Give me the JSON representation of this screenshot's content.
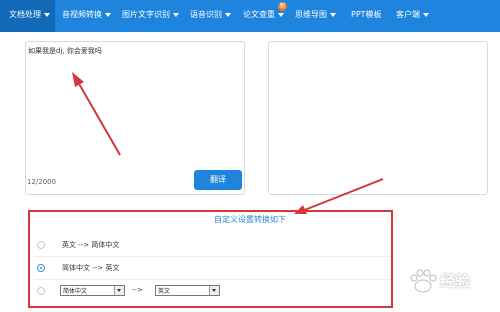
{
  "nav": {
    "items": [
      {
        "label": "文档处理",
        "active": true
      },
      {
        "label": "音视频转换"
      },
      {
        "label": "图片文字识别"
      },
      {
        "label": "语音识别"
      },
      {
        "label": "论文查重",
        "badge": "新"
      },
      {
        "label": "思维导图"
      },
      {
        "label": "PPT模板"
      },
      {
        "label": "客户端"
      }
    ]
  },
  "editor": {
    "input_text": "如果我是dj, 你会爱我吗",
    "counter": "12/2000",
    "translate_label": "翻译"
  },
  "settings": {
    "title": "自定义设置转换如下",
    "options": [
      {
        "label": "英文 --> 简体中文",
        "checked": false
      },
      {
        "label": "简体中文 --> 英文",
        "checked": true
      }
    ],
    "custom": {
      "source": "简体中文",
      "arrow": "-->",
      "target": "英文"
    }
  },
  "watermark": {
    "text": "经验"
  },
  "colors": {
    "nav_bg": "#1e84dd",
    "accent": "#2b86d6",
    "annotation": "#d13a3a"
  }
}
